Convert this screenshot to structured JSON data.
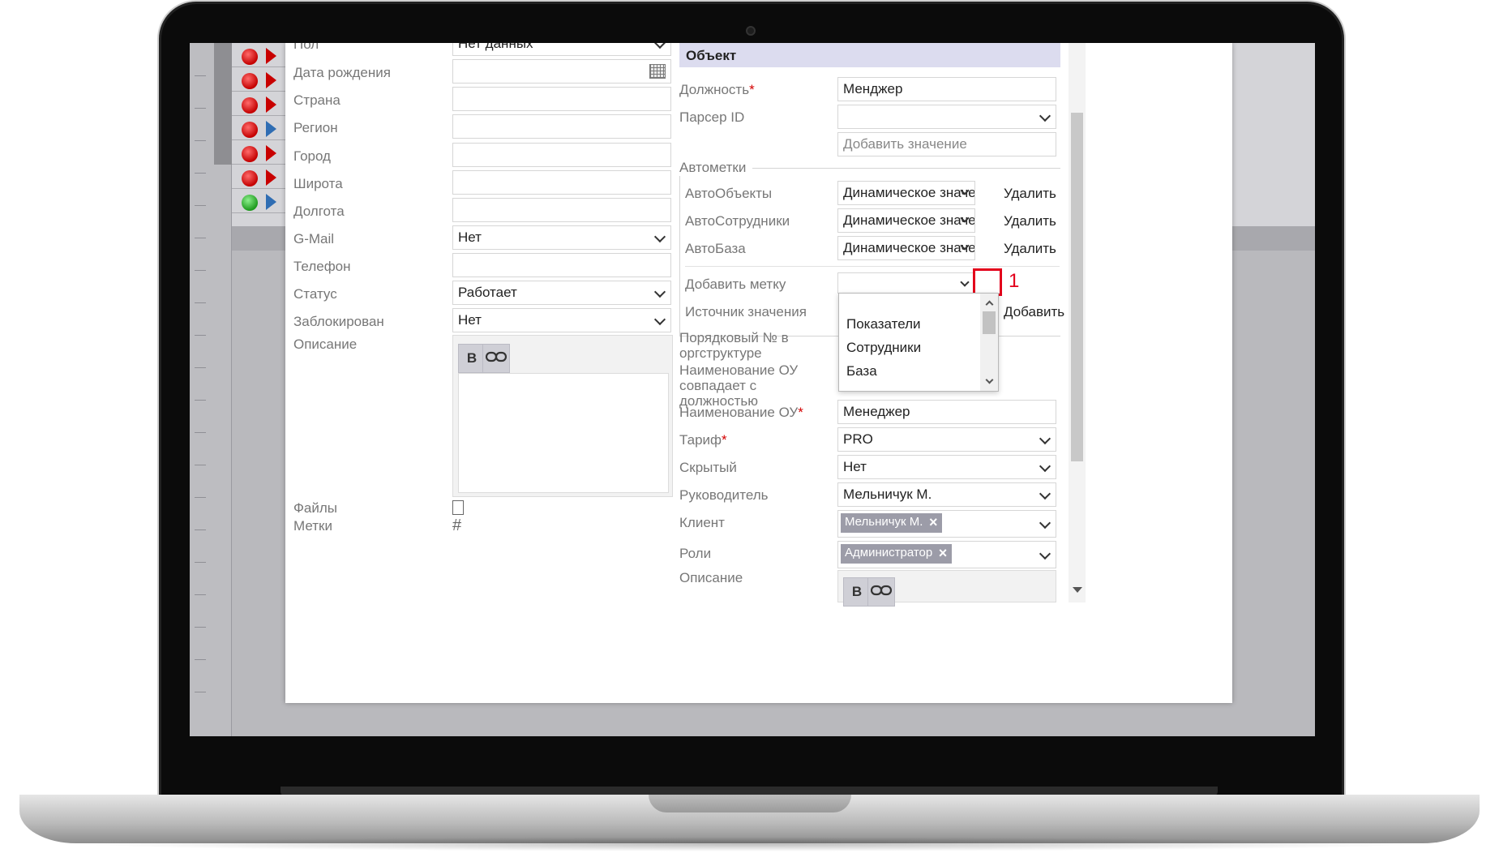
{
  "form_left": {
    "fields": [
      {
        "label": "Пол",
        "value": "Нет данных",
        "type": "select"
      },
      {
        "label": "Дата рождения",
        "value": "",
        "type": "date"
      },
      {
        "label": "Страна",
        "value": "",
        "type": "text"
      },
      {
        "label": "Регион",
        "value": "",
        "type": "text"
      },
      {
        "label": "Город",
        "value": "",
        "type": "text"
      },
      {
        "label": "Широта",
        "value": "",
        "type": "text"
      },
      {
        "label": "Долгота",
        "value": "",
        "type": "text"
      },
      {
        "label": "G-Mail",
        "value": "Нет",
        "type": "select"
      },
      {
        "label": "Телефон",
        "value": "",
        "type": "text"
      },
      {
        "label": "Статус",
        "value": "Работает",
        "type": "select"
      },
      {
        "label": "Заблокирован",
        "value": "Нет",
        "type": "select"
      }
    ],
    "description_label": "Описание",
    "editor_bold": "B",
    "files_label": "Файлы",
    "tags_label": "Метки",
    "tags_symbol": "#"
  },
  "form_right": {
    "section_title": "Объект",
    "position_label": "Должность",
    "position_value": "Менджер",
    "parser_label": "Парсер ID",
    "parser_value": "",
    "add_value_placeholder": "Добавить значение",
    "autotags_legend": "Автометки",
    "autotags": [
      {
        "label": "АвтоОбъекты",
        "value": "Динамическое значение",
        "action": "Удалить"
      },
      {
        "label": "АвтоСотрудники",
        "value": "Динамическое значение",
        "action": "Удалить"
      },
      {
        "label": "АвтоБаза",
        "value": "Динамическое значение",
        "action": "Удалить"
      }
    ],
    "add_tag_label": "Добавить метку",
    "source_label": "Источник значения",
    "add_action": "Добавить",
    "dropdown_options": [
      "Показатели",
      "Сотрудники",
      "База"
    ],
    "highlight_number": "1",
    "org_number_label": "Порядковый № в оргструктуре",
    "ou_match_label": "Наименование ОУ совпадает с должностью",
    "ou_name_label": "Наименование ОУ",
    "ou_name_value": "Менеджер",
    "tariff_label": "Тариф",
    "tariff_value": "PRO",
    "hidden_label": "Скрытый",
    "hidden_value": "Нет",
    "manager_label": "Руководитель",
    "manager_value": "Мельничук М.",
    "client_label": "Клиент",
    "client_tag": "Мельничук М.",
    "roles_label": "Роли",
    "roles_tag": "Администратор",
    "description_label": "Описание",
    "editor_bold": "B",
    "tag_remove": "×"
  }
}
